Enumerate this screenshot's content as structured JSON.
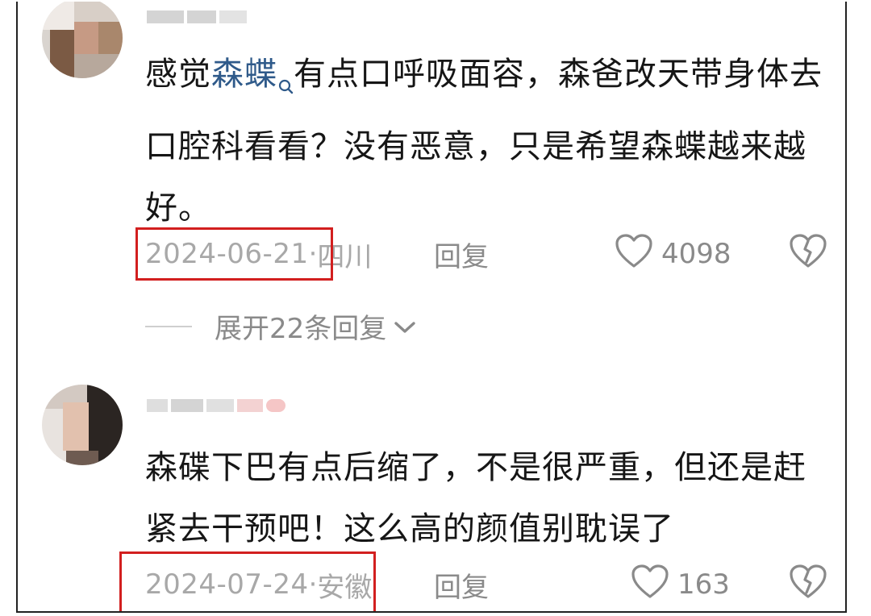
{
  "comments": [
    {
      "text_before": "感觉",
      "mention": "森蝶",
      "text_after": "有点口呼吸面容，森爸改天带身体去口腔科看看？没有恶意，只是希望森蝶越来越好。",
      "date": "2024-06-21",
      "location": "四川",
      "reply_label": "回复",
      "likes": "4098",
      "expand_label": "展开22条回复"
    },
    {
      "text": "森碟下巴有点后缩了，不是很严重，但还是赶紧去干预吧！这么高的颜值别耽误了",
      "date": "2024-07-24",
      "location": "安徽",
      "reply_label": "回复",
      "likes": "163"
    }
  ],
  "separator": " · ",
  "colors": {
    "highlight_box": "#d21f1f",
    "mention": "#2f5a8a",
    "meta_text": "#a8a8a8"
  },
  "icons": [
    "search-icon",
    "heart-outline-icon",
    "broken-heart-icon",
    "chevron-down-icon"
  ]
}
